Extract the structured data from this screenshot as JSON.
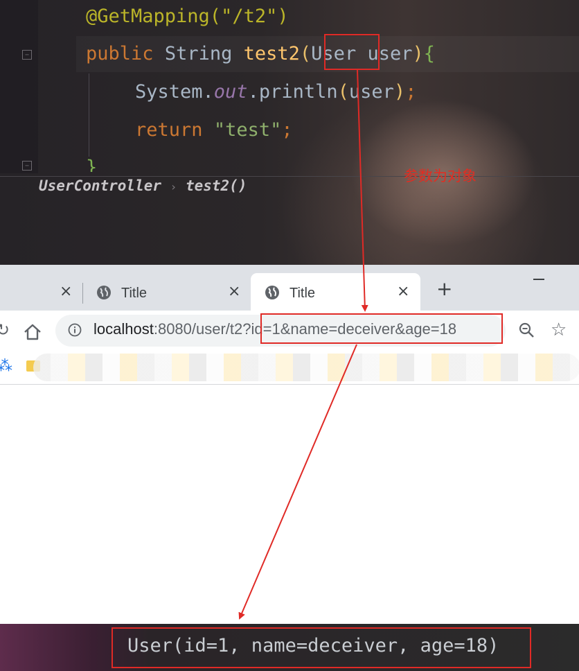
{
  "ide": {
    "line_annotation": "@GetMapping(\"/t2\")",
    "line_signature": {
      "kw": "public",
      "type": "String",
      "method": "test2",
      "open": "(",
      "param_type": "User",
      "param_name": " user",
      "close": ")",
      "brace": "{"
    },
    "line_print": {
      "cls": "System.",
      "field": "out",
      "call": ".println",
      "open": "(",
      "arg": "user",
      "close": ")",
      "semi": ";"
    },
    "line_return": {
      "kw": "return",
      "str": "\"test\"",
      "semi": ";"
    },
    "line_close": "}",
    "breadcrumb": {
      "class_name": "UserController",
      "separator": "›",
      "method_name": "test2()"
    },
    "note": "参数为对象"
  },
  "browser": {
    "tabs": [
      {
        "title": "Title",
        "close": "×"
      },
      {
        "title": "Title",
        "close": "×"
      }
    ],
    "first_tab_close": "×",
    "new_tab": "+",
    "url_host": "localhost",
    "url_rest": ":8080/user/t2?id=1&name=deceiver&age=18",
    "reload": "↻",
    "apps": "⁂"
  },
  "console": {
    "output": "User(id=1, name=deceiver, age=18)"
  },
  "colors": {
    "highlight_red": "#e02a26",
    "keyword": "#cc7832",
    "method": "#ffc66d",
    "string": "#8fb06c",
    "annotation": "#bbb529"
  },
  "icons": [
    "fold-icon",
    "globe-icon",
    "close-icon",
    "new-tab-icon",
    "minimize-icon",
    "reload-icon",
    "home-icon",
    "info-icon",
    "zoom-icon",
    "star-icon",
    "apps-icon",
    "folder-icon"
  ]
}
